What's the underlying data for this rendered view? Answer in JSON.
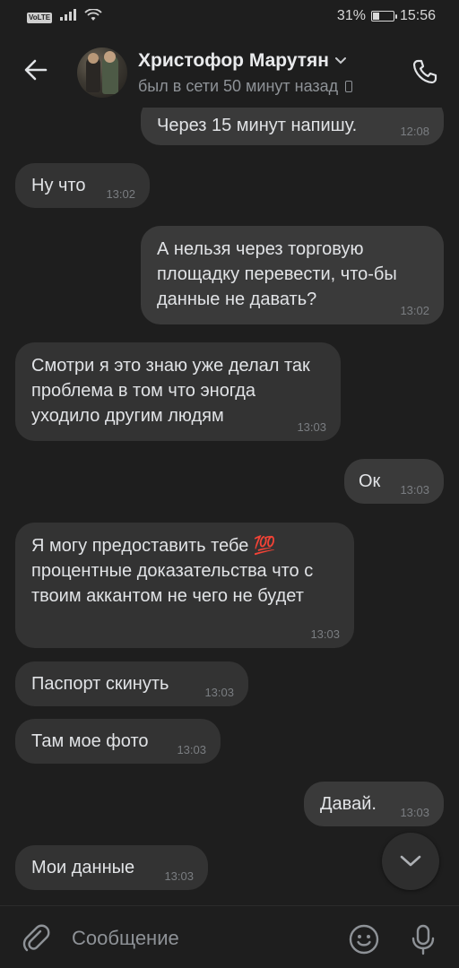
{
  "status_bar": {
    "volte": "VoLTE",
    "battery_percent_text": "31%",
    "battery_level": 0.31,
    "time": "15:56"
  },
  "header": {
    "contact_name": "Христофор Марутян",
    "last_seen": "был в сети 50 минут назад"
  },
  "messages": [
    {
      "direction": "out",
      "text": "Через 15 минут напишу.",
      "time": "12:08"
    },
    {
      "direction": "in",
      "text": "Ну что",
      "time": "13:02"
    },
    {
      "direction": "out",
      "text": "А нельзя через торговую площадку перевести, что-бы данные не давать?",
      "time": "13:02"
    },
    {
      "direction": "in",
      "text": "Смотри я это знаю уже делал так проблема в том что эногда уходило другим людям",
      "time": "13:03"
    },
    {
      "direction": "out",
      "text": "Ок",
      "time": "13:03"
    },
    {
      "direction": "in",
      "text": "Я могу предоставить тебе 💯 процентные доказательства что с твоим аккантом не чего не будет",
      "time": "13:03"
    },
    {
      "direction": "in",
      "text": "Паспорт скинуть",
      "time": "13:03"
    },
    {
      "direction": "in",
      "text": "Там мое фото",
      "time": "13:03"
    },
    {
      "direction": "out",
      "text": "Давай.",
      "time": "13:03"
    },
    {
      "direction": "in",
      "text": "Мои данные",
      "time": "13:03"
    }
  ],
  "composer": {
    "placeholder": "Сообщение"
  },
  "icons": {
    "back": "arrow-left-icon",
    "call": "phone-icon",
    "attach": "paperclip-icon",
    "emoji": "smile-icon",
    "mic": "microphone-icon",
    "scroll": "chevron-down-icon",
    "name_menu": "chevron-down-icon",
    "device": "mobile-device-icon"
  }
}
